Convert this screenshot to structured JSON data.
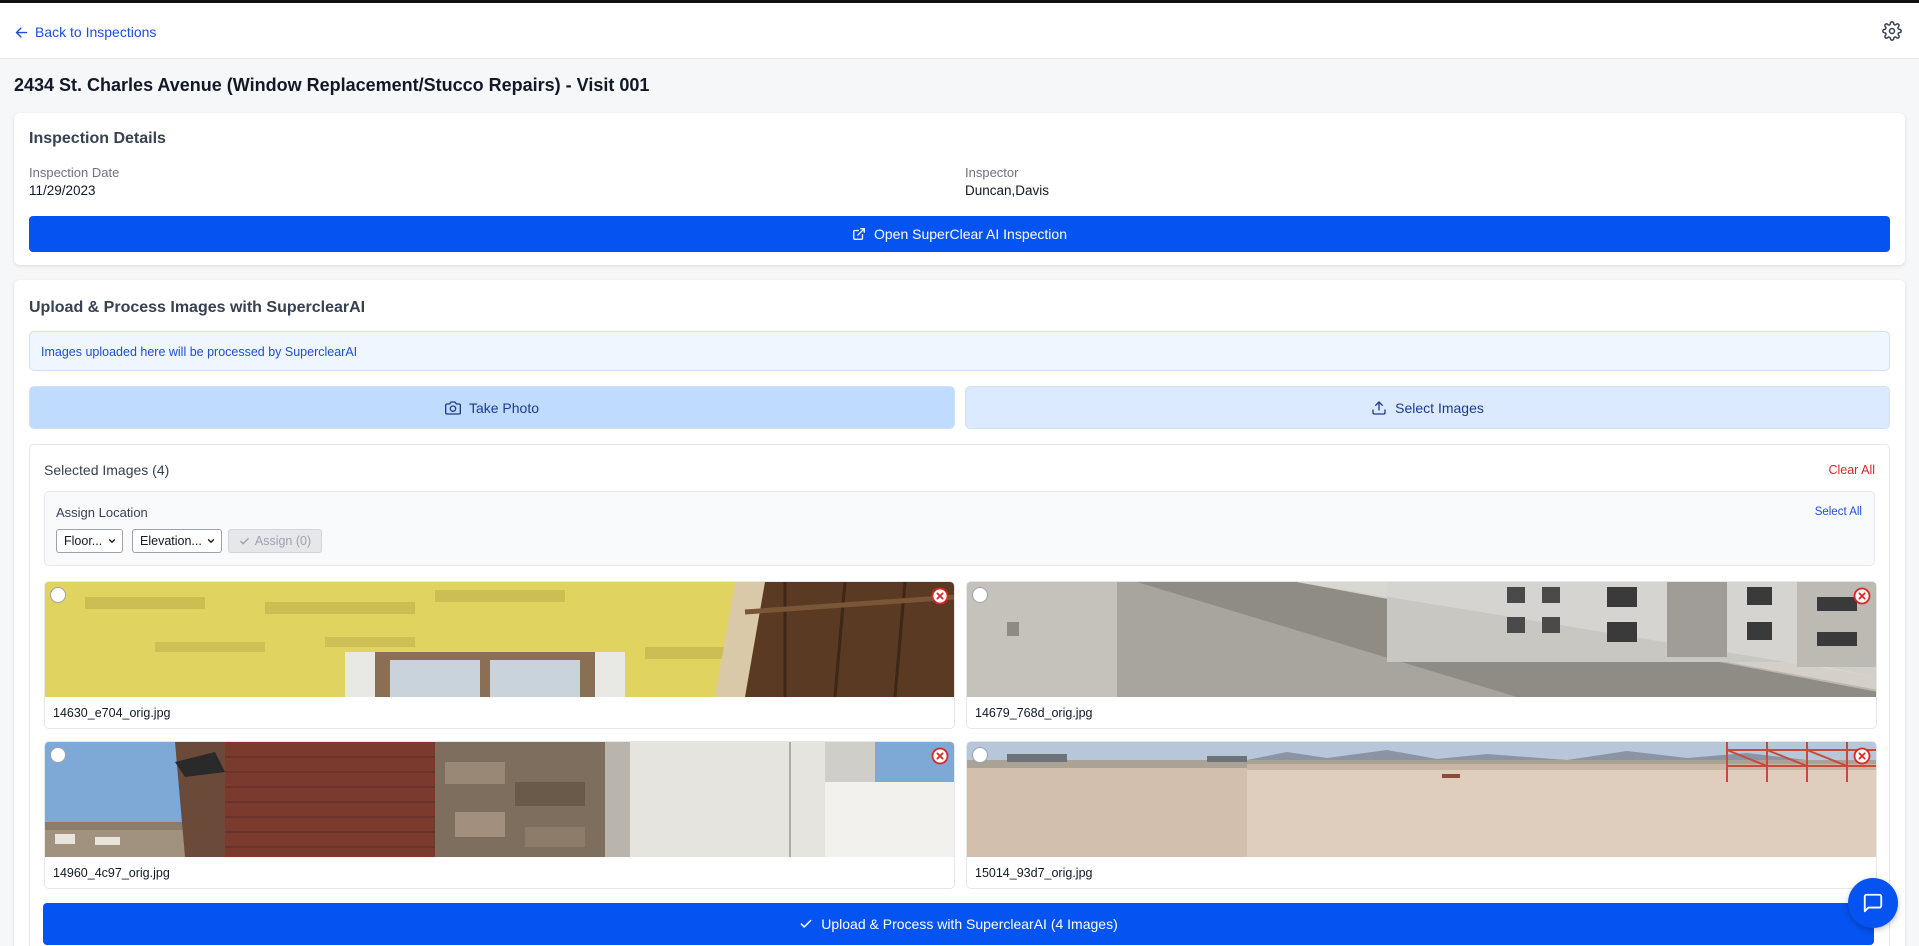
{
  "nav": {
    "back_label": "Back to Inspections"
  },
  "page": {
    "title": "2434 St. Charles Avenue (Window Replacement/Stucco Repairs) - Visit 001"
  },
  "details": {
    "title": "Inspection Details",
    "date_label": "Inspection Date",
    "date_value": "11/29/2023",
    "inspector_label": "Inspector",
    "inspector_value": "Duncan,Davis",
    "open_button": "Open SuperClear AI Inspection"
  },
  "upload": {
    "title": "Upload & Process Images with SuperclearAI",
    "info": "Images uploaded here will be processed by SuperclearAI",
    "take_photo": "Take Photo",
    "select_images": "Select Images",
    "selected_title": "Selected Images (4)",
    "clear_all": "Clear All",
    "assign_label": "Assign Location",
    "select_all": "Select All",
    "floor_select": "Floor...",
    "elevation_select": "Elevation...",
    "assign_button": "Assign (0)",
    "images": [
      {
        "name": "14630_e704_orig.jpg"
      },
      {
        "name": "14679_768d_orig.jpg"
      },
      {
        "name": "14960_4c97_orig.jpg"
      },
      {
        "name": "15014_93d7_orig.jpg"
      }
    ],
    "submit_button": "Upload & Process with SuperclearAI (4 Images)"
  },
  "colors": {
    "primary": "#0553f0",
    "danger": "#dc2626",
    "link": "#1d4ed8"
  }
}
